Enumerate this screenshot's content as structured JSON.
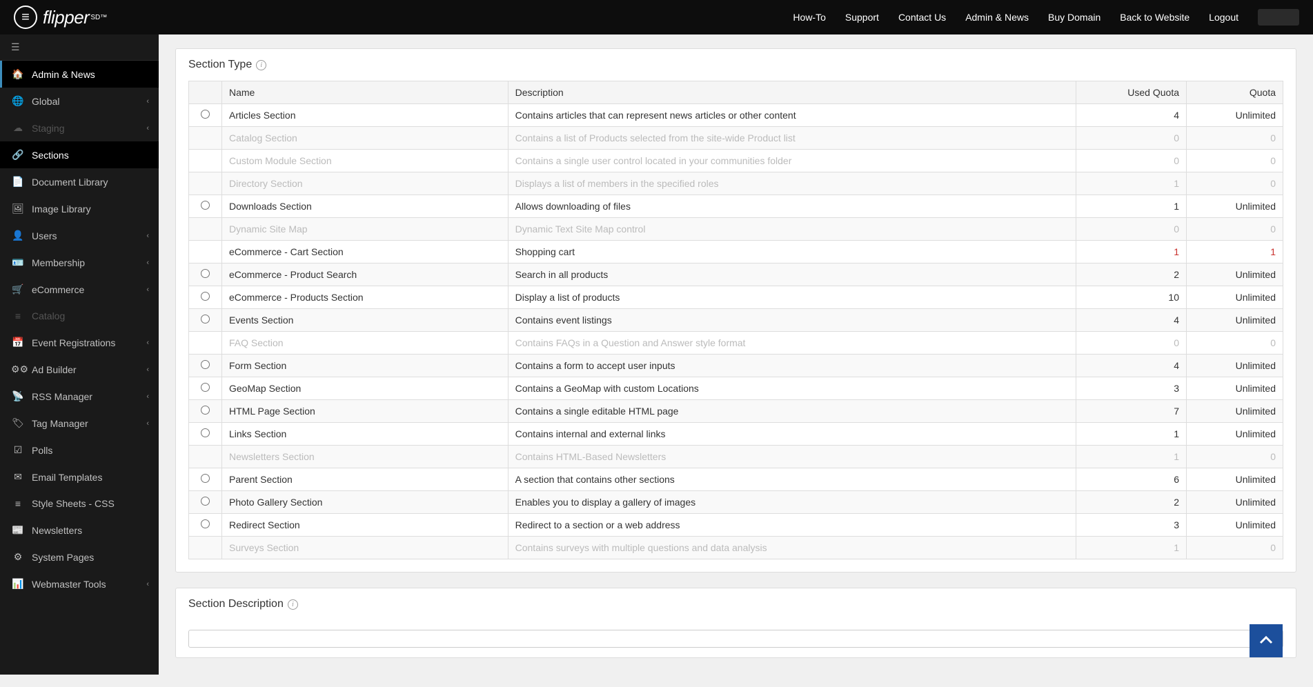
{
  "logo": {
    "text": "flipper",
    "sup": "SD™"
  },
  "topnav": {
    "howto": "How-To",
    "support": "Support",
    "contact": "Contact Us",
    "admin": "Admin & News",
    "buy": "Buy Domain",
    "back": "Back to Website",
    "logout": "Logout"
  },
  "sidebar": {
    "items": [
      {
        "label": "Admin & News",
        "icon": "home",
        "active": true,
        "chevron": false
      },
      {
        "label": "Global",
        "icon": "globe",
        "chevron": true
      },
      {
        "label": "Staging",
        "icon": "cloud",
        "chevron": true,
        "disabled": true
      },
      {
        "label": "Sections",
        "icon": "sitemap",
        "sub_active": true,
        "chevron": false
      },
      {
        "label": "Document Library",
        "icon": "file",
        "chevron": false
      },
      {
        "label": "Image Library",
        "icon": "image",
        "chevron": false
      },
      {
        "label": "Users",
        "icon": "user",
        "chevron": true
      },
      {
        "label": "Membership",
        "icon": "card",
        "chevron": true
      },
      {
        "label": "eCommerce",
        "icon": "cart",
        "chevron": true
      },
      {
        "label": "Catalog",
        "icon": "list",
        "chevron": false,
        "disabled": true
      },
      {
        "label": "Event Registrations",
        "icon": "calendar",
        "chevron": true
      },
      {
        "label": "Ad Builder",
        "icon": "gears",
        "chevron": true
      },
      {
        "label": "RSS Manager",
        "icon": "rss",
        "chevron": true
      },
      {
        "label": "Tag Manager",
        "icon": "tag",
        "chevron": true
      },
      {
        "label": "Polls",
        "icon": "check",
        "chevron": false
      },
      {
        "label": "Email Templates",
        "icon": "mail",
        "chevron": false
      },
      {
        "label": "Style Sheets - CSS",
        "icon": "css",
        "chevron": false
      },
      {
        "label": "Newsletters",
        "icon": "news",
        "chevron": false
      },
      {
        "label": "System Pages",
        "icon": "cog",
        "chevron": false
      },
      {
        "label": "Webmaster Tools",
        "icon": "chart",
        "chevron": true
      }
    ]
  },
  "section_type": {
    "title": "Section Type",
    "headers": {
      "name": "Name",
      "desc": "Description",
      "used": "Used Quota",
      "quota": "Quota"
    },
    "rows": [
      {
        "name": "Articles Section",
        "desc": "Contains articles that can represent news articles or other content",
        "used": "4",
        "quota": "Unlimited",
        "selectable": true
      },
      {
        "name": "Catalog Section",
        "desc": "Contains a list of Products selected from the site-wide Product list",
        "used": "0",
        "quota": "0",
        "selectable": false,
        "disabled": true
      },
      {
        "name": "Custom Module Section",
        "desc": "Contains a single user control located in your communities folder",
        "used": "0",
        "quota": "0",
        "selectable": false,
        "disabled": true
      },
      {
        "name": "Directory Section",
        "desc": "Displays a list of members in the specified roles",
        "used": "1",
        "quota": "0",
        "selectable": false,
        "disabled": true
      },
      {
        "name": "Downloads Section",
        "desc": "Allows downloading of files",
        "used": "1",
        "quota": "Unlimited",
        "selectable": true
      },
      {
        "name": "Dynamic Site Map",
        "desc": "Dynamic Text Site Map control",
        "used": "0",
        "quota": "0",
        "selectable": false,
        "disabled": true
      },
      {
        "name": "eCommerce - Cart Section",
        "desc": "Shopping cart",
        "used": "1",
        "quota": "1",
        "selectable": false,
        "quota_exceeded": true
      },
      {
        "name": "eCommerce - Product Search",
        "desc": "Search in all products",
        "used": "2",
        "quota": "Unlimited",
        "selectable": true
      },
      {
        "name": "eCommerce - Products Section",
        "desc": "Display a list of products",
        "used": "10",
        "quota": "Unlimited",
        "selectable": true
      },
      {
        "name": "Events Section",
        "desc": "Contains event listings",
        "used": "4",
        "quota": "Unlimited",
        "selectable": true
      },
      {
        "name": "FAQ Section",
        "desc": "Contains FAQs in a Question and Answer style format",
        "used": "0",
        "quota": "0",
        "selectable": false,
        "disabled": true
      },
      {
        "name": "Form Section",
        "desc": "Contains a form to accept user inputs",
        "used": "4",
        "quota": "Unlimited",
        "selectable": true
      },
      {
        "name": "GeoMap Section",
        "desc": "Contains a GeoMap with custom Locations",
        "used": "3",
        "quota": "Unlimited",
        "selectable": true
      },
      {
        "name": "HTML Page Section",
        "desc": "Contains a single editable HTML page",
        "used": "7",
        "quota": "Unlimited",
        "selectable": true
      },
      {
        "name": "Links Section",
        "desc": "Contains internal and external links",
        "used": "1",
        "quota": "Unlimited",
        "selectable": true
      },
      {
        "name": "Newsletters Section",
        "desc": "Contains HTML-Based Newsletters",
        "used": "1",
        "quota": "0",
        "selectable": false,
        "disabled": true
      },
      {
        "name": "Parent Section",
        "desc": "A section that contains other sections",
        "used": "6",
        "quota": "Unlimited",
        "selectable": true
      },
      {
        "name": "Photo Gallery Section",
        "desc": "Enables you to display a gallery of images",
        "used": "2",
        "quota": "Unlimited",
        "selectable": true
      },
      {
        "name": "Redirect Section",
        "desc": "Redirect to a section or a web address",
        "used": "3",
        "quota": "Unlimited",
        "selectable": true
      },
      {
        "name": "Surveys Section",
        "desc": "Contains surveys with multiple questions and data analysis",
        "used": "1",
        "quota": "0",
        "selectable": false,
        "disabled": true
      }
    ]
  },
  "section_description": {
    "title": "Section Description"
  }
}
